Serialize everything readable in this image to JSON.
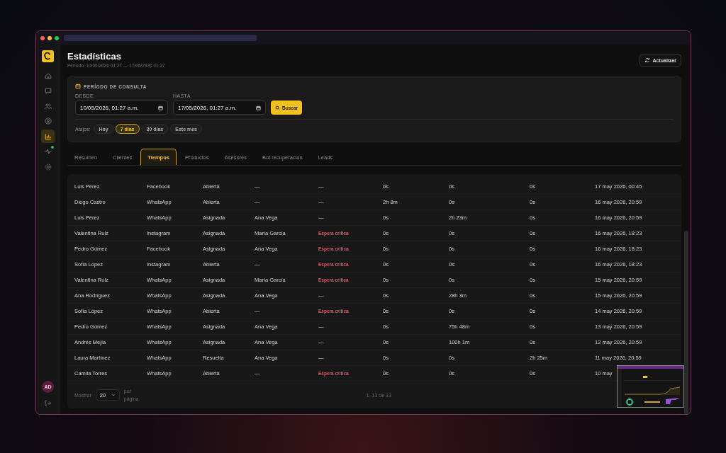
{
  "header": {
    "title": "Estadísticas",
    "subtitle": "Período: 10/05/2026 01:27 — 17/05/2026 01:27",
    "refresh_button": "Actualizar"
  },
  "sidebar": {
    "items": [
      {
        "kind": "home",
        "selected": false,
        "notification": false
      },
      {
        "kind": "chat",
        "selected": false,
        "notification": false
      },
      {
        "kind": "users",
        "selected": false,
        "notification": false
      },
      {
        "kind": "user",
        "selected": false,
        "notification": false
      },
      {
        "kind": "chart",
        "selected": true,
        "notification": false
      },
      {
        "kind": "activity",
        "selected": false,
        "notification": true
      },
      {
        "kind": "settings",
        "selected": false,
        "notification": false
      }
    ],
    "avatar": "AD"
  },
  "period": {
    "heading": "PERÍODO DE CONSULTA",
    "from": {
      "label": "DESDE",
      "value": "10/05/2026, 01:27 a.m."
    },
    "to": {
      "label": "HASTA",
      "value": "17/05/2026, 01:27 a.m."
    },
    "search_button": "Buscar",
    "shortcuts_label": "Atajos:",
    "shortcuts": [
      {
        "label": "Hoy",
        "selected": false
      },
      {
        "label": "7 días",
        "selected": true
      },
      {
        "label": "30 días",
        "selected": false
      },
      {
        "label": "Este mes",
        "selected": false
      }
    ]
  },
  "tabs": [
    {
      "label": "Resumen",
      "selected": false
    },
    {
      "label": "Clientes",
      "selected": false
    },
    {
      "label": "Tiempos",
      "selected": true
    },
    {
      "label": "Productos",
      "selected": false
    },
    {
      "label": "Asesores",
      "selected": false
    },
    {
      "label": "Bot recuperación",
      "selected": false
    },
    {
      "label": "Leads",
      "selected": false
    }
  ],
  "table": {
    "rows": [
      {
        "critical": false,
        "cells": [
          "Luis Pérez",
          "Facebook",
          "Abierta",
          "—",
          "—",
          "0s",
          "0s",
          "0s",
          "17 may 2026, 00:45"
        ]
      },
      {
        "critical": false,
        "cells": [
          "Diego Castro",
          "WhatsApp",
          "Abierta",
          "—",
          "—",
          "2h 8m",
          "0s",
          "0s",
          "16 may 2026, 20:59"
        ]
      },
      {
        "critical": false,
        "cells": [
          "Luis Pérez",
          "WhatsApp",
          "Asignada",
          "Ana Vega",
          "—",
          "0s",
          "2h 23m",
          "0s",
          "16 may 2026, 20:59"
        ]
      },
      {
        "critical": true,
        "cells": [
          "Valentina Ruiz",
          "Instagram",
          "Asignada",
          "María García",
          "Espera crítica",
          "0s",
          "0s",
          "0s",
          "16 may 2026, 18:23"
        ]
      },
      {
        "critical": true,
        "cells": [
          "Pedro Gómez",
          "Facebook",
          "Asignada",
          "Ana Vega",
          "Espera crítica",
          "0s",
          "0s",
          "0s",
          "16 may 2026, 18:23"
        ]
      },
      {
        "critical": true,
        "cells": [
          "Sofía López",
          "Instagram",
          "Abierta",
          "—",
          "Espera crítica",
          "0s",
          "0s",
          "0s",
          "16 may 2026, 18:23"
        ]
      },
      {
        "critical": true,
        "cells": [
          "Valentina Ruiz",
          "WhatsApp",
          "Asignada",
          "María García",
          "Espera crítica",
          "0s",
          "0s",
          "0s",
          "15 may 2026, 20:59"
        ]
      },
      {
        "critical": false,
        "cells": [
          "Ana Rodríguez",
          "WhatsApp",
          "Asignada",
          "Ana Vega",
          "—",
          "0s",
          "28h 3m",
          "0s",
          "15 may 2026, 20:59"
        ]
      },
      {
        "critical": true,
        "cells": [
          "Sofía López",
          "WhatsApp",
          "Abierta",
          "—",
          "Espera crítica",
          "0s",
          "0s",
          "0s",
          "14 may 2026, 20:59"
        ]
      },
      {
        "critical": false,
        "cells": [
          "Pedro Gómez",
          "WhatsApp",
          "Asignada",
          "Ana Vega",
          "—",
          "0s",
          "75h 48m",
          "0s",
          "13 may 2026, 20:59"
        ]
      },
      {
        "critical": false,
        "cells": [
          "Andrés Mejía",
          "WhatsApp",
          "Asignada",
          "Ana Vega",
          "—",
          "0s",
          "100h 1m",
          "0s",
          "12 may 2026, 20:59"
        ]
      },
      {
        "critical": false,
        "cells": [
          "Laura Martínez",
          "WhatsApp",
          "Resuelta",
          "Ana Vega",
          "—",
          "0s",
          "0s",
          "2h 25m",
          "11 may 2026, 20:59"
        ]
      },
      {
        "critical": true,
        "cells": [
          "Camila Torres",
          "WhatsApp",
          "Abierta",
          "—",
          "Espera crítica",
          "0s",
          "0s",
          "0s",
          "10 may"
        ]
      }
    ],
    "footer": {
      "show_label": "Mostrar",
      "page_size": "20",
      "per_page_label": "por página",
      "range": "1–13 de 13"
    }
  }
}
